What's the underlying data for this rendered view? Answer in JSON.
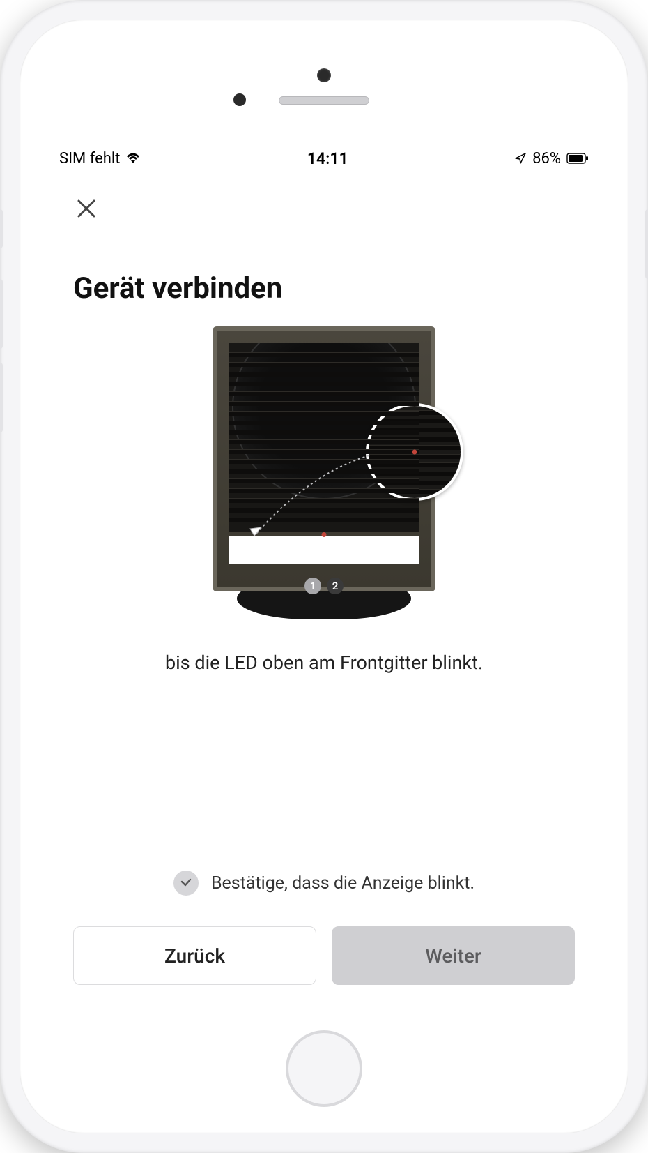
{
  "status_bar": {
    "sim_text": "SIM fehlt",
    "time": "14:11",
    "battery_percent": "86%"
  },
  "header": {
    "close_label": "Schließen"
  },
  "page": {
    "title": "Gerät verbinden",
    "instruction": "bis die LED oben am Frontgitter blinkt.",
    "pager_1": "1",
    "pager_2": "2"
  },
  "confirm": {
    "label": "Bestätige, dass die Anzeige blinkt."
  },
  "buttons": {
    "back": "Zurück",
    "next": "Weiter"
  }
}
